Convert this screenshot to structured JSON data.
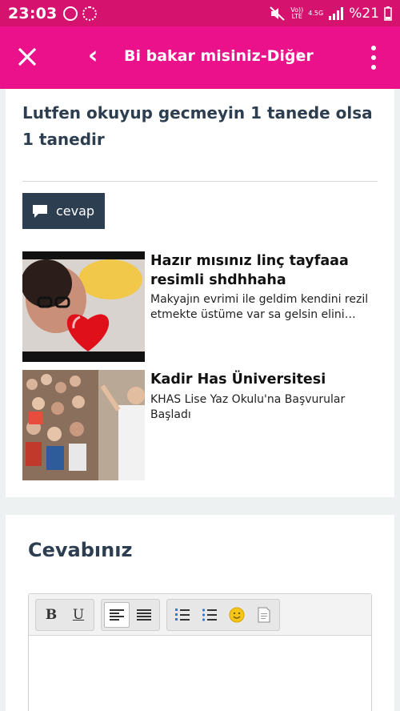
{
  "status": {
    "time": "23:03",
    "volte": "Vo))",
    "lte": "LTE",
    "net": "4.5G",
    "battery": "%21"
  },
  "appbar": {
    "title": "Bi bakar misiniz-Diğer"
  },
  "question": {
    "title": "Lutfen okuyup gecmeyin 1 tanede olsa 1 tanedir",
    "reply_label": "cevap"
  },
  "related": [
    {
      "title": "Hazır mısınız linç tayfaaa resimli shdhhaha",
      "desc": "Makyajın evrimi ile geldim kendini rezil etmekte üstüme var sa gelsin elini…"
    },
    {
      "title": "Kadir Has Üniversitesi",
      "desc": "KHAS Lise Yaz Okulu'na Başvurular Başladı"
    }
  ],
  "answer": {
    "heading": "Cevabınız"
  },
  "editor_toolbar": {
    "bold": "B",
    "underline": "U"
  },
  "colors": {
    "statusbar": "#d6126f",
    "appbar": "#ea118a",
    "navy": "#2d3e50"
  }
}
